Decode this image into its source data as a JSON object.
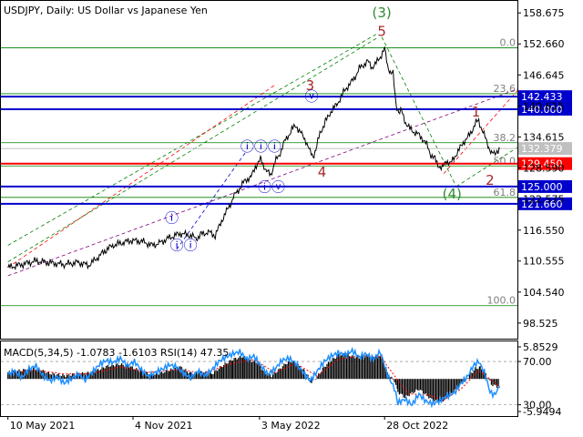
{
  "chart_data": {
    "type": "line",
    "title": "USDJPY, Daily:  US Dollar vs Japanese Yen",
    "price_ticks": [
      "158.675",
      "152.660",
      "146.645",
      "140.615",
      "134.615",
      "128.590",
      "122.575",
      "116.550",
      "110.555",
      "104.540",
      "98.525"
    ],
    "price_range": [
      95.5,
      161.0
    ],
    "date_ticks": [
      {
        "label": "10 May 2021",
        "t": 0
      },
      {
        "label": "4 Nov 2021",
        "t": 178
      },
      {
        "label": "3 May 2022",
        "t": 358
      },
      {
        "label": "28 Oct 2022",
        "t": 536
      }
    ],
    "t_range": [
      -10,
      725
    ],
    "price_series": [
      [
        0,
        109.3
      ],
      [
        20,
        109.9
      ],
      [
        40,
        110.6
      ],
      [
        60,
        110.2
      ],
      [
        80,
        109.9
      ],
      [
        100,
        110.3
      ],
      [
        115,
        109.7
      ],
      [
        130,
        111.5
      ],
      [
        140,
        112.8
      ],
      [
        150,
        113.6
      ],
      [
        155,
        113.8
      ],
      [
        165,
        114.2
      ],
      [
        175,
        114.5
      ],
      [
        190,
        114.4
      ],
      [
        205,
        113.6
      ],
      [
        215,
        114.0
      ],
      [
        230,
        115.1
      ],
      [
        245,
        115.9
      ],
      [
        260,
        115.5
      ],
      [
        268,
        114.9
      ],
      [
        275,
        115.7
      ],
      [
        285,
        116.2
      ],
      [
        295,
        115.5
      ],
      [
        305,
        118.6
      ],
      [
        315,
        121.2
      ],
      [
        322,
        123.2
      ],
      [
        332,
        125.1
      ],
      [
        338,
        126.3
      ],
      [
        346,
        126.8
      ],
      [
        352,
        128.9
      ],
      [
        360,
        130.2
      ],
      [
        368,
        128.0
      ],
      [
        374,
        127.2
      ],
      [
        380,
        129.8
      ],
      [
        386,
        131.0
      ],
      [
        392,
        133.3
      ],
      [
        398,
        134.6
      ],
      [
        404,
        136.1
      ],
      [
        410,
        136.8
      ],
      [
        418,
        135.1
      ],
      [
        424,
        133.9
      ],
      [
        430,
        131.7
      ],
      [
        434,
        130.8
      ],
      [
        438,
        132.1
      ],
      [
        444,
        135.3
      ],
      [
        452,
        137.6
      ],
      [
        460,
        139.6
      ],
      [
        468,
        140.9
      ],
      [
        476,
        142.9
      ],
      [
        482,
        144.2
      ],
      [
        488,
        145.1
      ],
      [
        494,
        146.3
      ],
      [
        500,
        147.9
      ],
      [
        506,
        148.6
      ],
      [
        512,
        149.3
      ],
      [
        518,
        148.1
      ],
      [
        524,
        148.9
      ],
      [
        530,
        150.2
      ],
      [
        536,
        151.7
      ],
      [
        540,
        148.6
      ],
      [
        544,
        147.2
      ],
      [
        548,
        146.8
      ],
      [
        552,
        141.2
      ],
      [
        556,
        139.4
      ],
      [
        560,
        139.6
      ],
      [
        566,
        137.4
      ],
      [
        572,
        136.2
      ],
      [
        578,
        135.6
      ],
      [
        584,
        135.1
      ],
      [
        590,
        134.3
      ],
      [
        596,
        133.1
      ],
      [
        602,
        131.1
      ],
      [
        606,
        130.7
      ],
      [
        612,
        129.2
      ],
      [
        618,
        128.5
      ],
      [
        624,
        130.1
      ],
      [
        630,
        129.4
      ],
      [
        636,
        130.9
      ],
      [
        642,
        132.1
      ],
      [
        648,
        133.6
      ],
      [
        654,
        134.4
      ],
      [
        660,
        135.8
      ],
      [
        666,
        137.4
      ],
      [
        670,
        137.7
      ],
      [
        676,
        135.6
      ],
      [
        680,
        134.2
      ],
      [
        684,
        132.8
      ],
      [
        688,
        131.5
      ],
      [
        692,
        131.2
      ],
      [
        696,
        131.9
      ],
      [
        700,
        132.4
      ]
    ],
    "horizontal_levels": [
      {
        "value": 142.433,
        "label": "142.433",
        "color": "#0000cc"
      },
      {
        "value": 140.0,
        "label": "140.000",
        "color": "#0000cc"
      },
      {
        "value": 132.379,
        "label": "132.379",
        "color": "#c0c0c0"
      },
      {
        "value": 129.45,
        "label": "129.450",
        "color": "#ff0000"
      },
      {
        "value": 125.0,
        "label": "125.000",
        "color": "#0000cc"
      },
      {
        "value": 121.66,
        "label": "121.660",
        "color": "#0000cc"
      }
    ],
    "fibonacci_levels": [
      {
        "value": 151.9,
        "label": "0.0"
      },
      {
        "value": 143.0,
        "label": "23.6"
      },
      {
        "value": 133.5,
        "label": "38.2"
      },
      {
        "value": 129.0,
        "label": "50.0"
      },
      {
        "value": 122.9,
        "label": "61.8"
      },
      {
        "value": 101.9,
        "label": "100.0"
      }
    ],
    "fib_color": "#008000",
    "wave_labels": [
      {
        "text": "(3)",
        "t": 532,
        "price": 157.8,
        "color": "#2e8b2e"
      },
      {
        "text": "5",
        "t": 532,
        "price": 154.2,
        "color": "#a52a2a"
      },
      {
        "text": "3",
        "t": 430,
        "price": 143.7,
        "color": "#a52a2a"
      },
      {
        "text": "ⓥ",
        "t": 432,
        "price": 141.6,
        "color": "#0000cc"
      },
      {
        "text": "ⓘⓘⓘ",
        "t": 360,
        "price": 131.9,
        "color": "#0000cc"
      },
      {
        "text": "4",
        "t": 447,
        "price": 126.9,
        "color": "#a52a2a"
      },
      {
        "text": "ⓘⓥ",
        "t": 375,
        "price": 124.0,
        "color": "#0000cc"
      },
      {
        "text": "ⓘ",
        "t": 233,
        "price": 118.0,
        "color": "#0000cc"
      },
      {
        "text": "ⓘⓘ",
        "t": 250,
        "price": 112.7,
        "color": "#0000cc"
      },
      {
        "text": "1",
        "t": 666,
        "price": 138.6,
        "color": "#a52a2a"
      },
      {
        "text": "2",
        "t": 686,
        "price": 125.3,
        "color": "#a52a2a"
      },
      {
        "text": "(4)",
        "t": 632,
        "price": 122.7,
        "color": "#2e8b2e"
      }
    ],
    "trend_lines": [
      {
        "from": [
          0,
          110.4
        ],
        "to": [
          525,
          153.8
        ],
        "color": "#008000",
        "style": "dashed"
      },
      {
        "from": [
          0,
          113.6
        ],
        "to": [
          525,
          154.6
        ],
        "color": "#008000",
        "style": "dashed"
      },
      {
        "from": [
          0,
          107.7
        ],
        "to": [
          725,
          143.9
        ],
        "color": "#800080",
        "style": "dashed"
      },
      {
        "from": [
          0,
          109.3
        ],
        "to": [
          380,
          144.7
        ],
        "color": "#ff0000",
        "style": "dashed"
      },
      {
        "from": [
          620,
          127.5
        ],
        "to": [
          725,
          143.6
        ],
        "color": "#ff0000",
        "style": "dashed"
      },
      {
        "from": [
          638,
          125.0
        ],
        "to": [
          725,
          132.6
        ],
        "color": "#008000",
        "style": "dashed"
      },
      {
        "from": [
          532,
          154.0
        ],
        "to": [
          638,
          125.0
        ],
        "color": "#008000",
        "style": "dashed"
      },
      {
        "from": [
          240,
          112.8
        ],
        "to": [
          340,
          132.0
        ],
        "color": "#0000cc",
        "style": "dashed"
      }
    ],
    "indicator": {
      "label": "MACD(5,34,5) -1.0783 -1.6103 RSI(14) 47.35",
      "ticks": [
        "5.8529",
        "70.00",
        "30.00",
        "-5.9494"
      ],
      "macd_range": [
        -5.9494,
        5.8529
      ],
      "rsi_range": [
        23.8,
        83.5
      ],
      "rsi_levels": [
        70,
        30
      ],
      "macd_histogram": [
        [
          0,
          1.2
        ],
        [
          20,
          1.6
        ],
        [
          40,
          1.9
        ],
        [
          60,
          1.0
        ],
        [
          80,
          0.6
        ],
        [
          100,
          0.9
        ],
        [
          120,
          1.2
        ],
        [
          140,
          2.3
        ],
        [
          160,
          2.7
        ],
        [
          175,
          2.2
        ],
        [
          190,
          1.4
        ],
        [
          205,
          0.8
        ],
        [
          215,
          1.0
        ],
        [
          230,
          1.6
        ],
        [
          245,
          2.2
        ],
        [
          260,
          1.0
        ],
        [
          275,
          1.2
        ],
        [
          290,
          0.9
        ],
        [
          305,
          2.4
        ],
        [
          320,
          3.6
        ],
        [
          335,
          4.1
        ],
        [
          345,
          3.4
        ],
        [
          355,
          3.0
        ],
        [
          365,
          1.2
        ],
        [
          375,
          0.6
        ],
        [
          385,
          1.6
        ],
        [
          395,
          2.8
        ],
        [
          405,
          3.3
        ],
        [
          415,
          2.3
        ],
        [
          425,
          1.0
        ],
        [
          432,
          -0.6
        ],
        [
          440,
          0.4
        ],
        [
          450,
          2.2
        ],
        [
          460,
          3.4
        ],
        [
          470,
          4.3
        ],
        [
          480,
          4.7
        ],
        [
          490,
          4.1
        ],
        [
          500,
          3.9
        ],
        [
          510,
          4.3
        ],
        [
          520,
          4.0
        ],
        [
          530,
          4.4
        ],
        [
          540,
          1.0
        ],
        [
          550,
          -0.4
        ],
        [
          555,
          -2.4
        ],
        [
          565,
          -3.4
        ],
        [
          575,
          -2.6
        ],
        [
          585,
          -1.9
        ],
        [
          595,
          -2.9
        ],
        [
          605,
          -4.0
        ],
        [
          615,
          -4.3
        ],
        [
          625,
          -3.3
        ],
        [
          635,
          -2.4
        ],
        [
          645,
          -1.0
        ],
        [
          655,
          0.4
        ],
        [
          665,
          1.9
        ],
        [
          672,
          2.1
        ],
        [
          680,
          0.9
        ],
        [
          688,
          -1.0
        ],
        [
          696,
          -1.4
        ],
        [
          700,
          -1.1
        ]
      ],
      "macd_signal": [
        [
          0,
          1.0
        ],
        [
          40,
          1.6
        ],
        [
          80,
          0.9
        ],
        [
          120,
          1.0
        ],
        [
          160,
          2.2
        ],
        [
          200,
          1.2
        ],
        [
          240,
          1.7
        ],
        [
          280,
          1.1
        ],
        [
          320,
          2.9
        ],
        [
          350,
          3.5
        ],
        [
          380,
          1.2
        ],
        [
          410,
          2.8
        ],
        [
          440,
          0.5
        ],
        [
          470,
          3.6
        ],
        [
          500,
          4.2
        ],
        [
          530,
          4.1
        ],
        [
          550,
          0.6
        ],
        [
          570,
          -2.7
        ],
        [
          600,
          -3.0
        ],
        [
          620,
          -3.9
        ],
        [
          645,
          -1.8
        ],
        [
          670,
          1.5
        ],
        [
          690,
          -0.4
        ],
        [
          700,
          -1.6
        ]
      ],
      "rsi": [
        [
          0,
          58
        ],
        [
          10,
          61
        ],
        [
          20,
          55
        ],
        [
          30,
          63
        ],
        [
          40,
          66
        ],
        [
          50,
          57
        ],
        [
          60,
          52
        ],
        [
          70,
          56
        ],
        [
          80,
          50
        ],
        [
          90,
          54
        ],
        [
          100,
          58
        ],
        [
          110,
          53
        ],
        [
          120,
          60
        ],
        [
          130,
          67
        ],
        [
          140,
          71
        ],
        [
          150,
          69
        ],
        [
          160,
          73
        ],
        [
          170,
          66
        ],
        [
          180,
          70
        ],
        [
          190,
          62
        ],
        [
          200,
          56
        ],
        [
          210,
          60
        ],
        [
          220,
          63
        ],
        [
          230,
          67
        ],
        [
          240,
          65
        ],
        [
          250,
          59
        ],
        [
          260,
          55
        ],
        [
          270,
          61
        ],
        [
          280,
          57
        ],
        [
          290,
          62
        ],
        [
          300,
          70
        ],
        [
          310,
          74
        ],
        [
          320,
          77
        ],
        [
          330,
          79
        ],
        [
          340,
          72
        ],
        [
          350,
          75
        ],
        [
          360,
          66
        ],
        [
          370,
          58
        ],
        [
          380,
          63
        ],
        [
          390,
          71
        ],
        [
          400,
          73
        ],
        [
          410,
          68
        ],
        [
          420,
          60
        ],
        [
          430,
          52
        ],
        [
          440,
          61
        ],
        [
          450,
          70
        ],
        [
          460,
          75
        ],
        [
          470,
          78
        ],
        [
          480,
          76
        ],
        [
          490,
          80
        ],
        [
          500,
          74
        ],
        [
          510,
          77
        ],
        [
          520,
          72
        ],
        [
          530,
          79
        ],
        [
          540,
          58
        ],
        [
          550,
          45
        ],
        [
          555,
          32
        ],
        [
          565,
          35
        ],
        [
          575,
          30
        ],
        [
          585,
          40
        ],
        [
          595,
          33
        ],
        [
          605,
          31
        ],
        [
          615,
          34
        ],
        [
          625,
          38
        ],
        [
          635,
          41
        ],
        [
          645,
          50
        ],
        [
          655,
          57
        ],
        [
          662,
          66
        ],
        [
          670,
          70
        ],
        [
          678,
          60
        ],
        [
          686,
          42
        ],
        [
          692,
          39
        ],
        [
          700,
          47
        ]
      ]
    }
  }
}
